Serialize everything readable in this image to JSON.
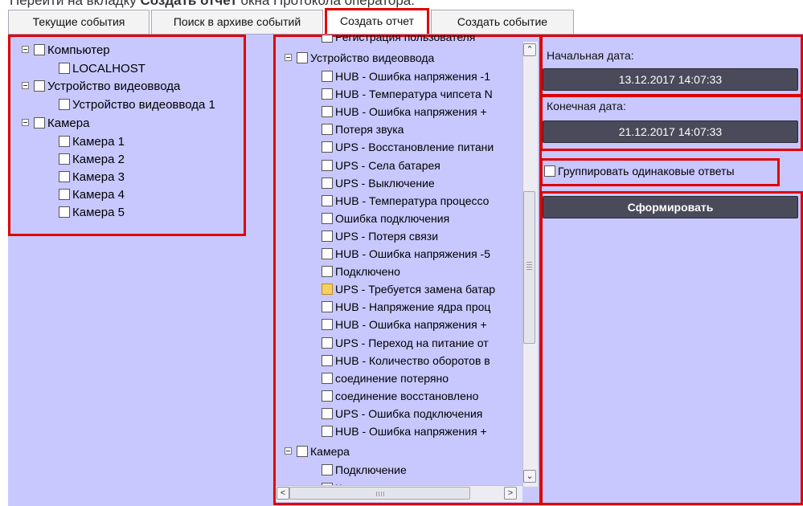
{
  "caption": {
    "prefix": "Перейти на вкладку ",
    "bold": "Создать отчет",
    "suffix": " окна Протокола оператора."
  },
  "tabs": [
    {
      "label": "Текущие события"
    },
    {
      "label": "Поиск в архиве событий"
    },
    {
      "label": "Создать отчет"
    },
    {
      "label": "Создать событие"
    }
  ],
  "objects_tree": {
    "computer": {
      "label": "Компьютер",
      "children": [
        "LOCALHOST"
      ]
    },
    "video_input": {
      "label": "Устройство видеоввода",
      "children": [
        "Устройство видеоввода 1"
      ]
    },
    "camera": {
      "label": "Камера",
      "children": [
        "Камера 1",
        "Камера 2",
        "Камера 3",
        "Камера 4",
        "Камера 5"
      ]
    }
  },
  "events_tree": {
    "top_partial": "Регистрация пользователя",
    "group1": "Устройство видеоввода",
    "items": [
      "HUB - Ошибка напряжения -1",
      "HUB - Температура чипсета N",
      "HUB - Ошибка напряжения +",
      "Потеря звука",
      "UPS - Восстановление питани",
      "UPS - Села батарея",
      "UPS - Выключение",
      "HUB - Температура процессо",
      "Ошибка подключения",
      "UPS - Потеря связи",
      "HUB - Ошибка напряжения -5",
      "Подключено",
      "UPS - Требуется замена батар",
      "HUB - Напряжение ядра проц",
      "HUB - Ошибка напряжения +",
      "UPS - Переход на питание от",
      "HUB - Количество оборотов в",
      "соединение потеряно",
      "соединение восстановлено",
      "UPS - Ошибка подключения",
      "HUB - Ошибка напряжения +"
    ],
    "partial_item_index": 12,
    "group2": "Камера",
    "group2_items": [
      "Подключение",
      "К"
    ]
  },
  "report": {
    "start_label": "Начальная дата:",
    "start_value": "13.12.2017 14:07:33",
    "end_label": "Конечная дата:",
    "end_value": "21.12.2017 14:07:33",
    "group_label": "Группировать одинаковые ответы",
    "generate_label": "Сформировать"
  },
  "colors": {
    "panel": "#c8c8ff",
    "highlight": "#e00000",
    "field": "#4a4a5a"
  }
}
